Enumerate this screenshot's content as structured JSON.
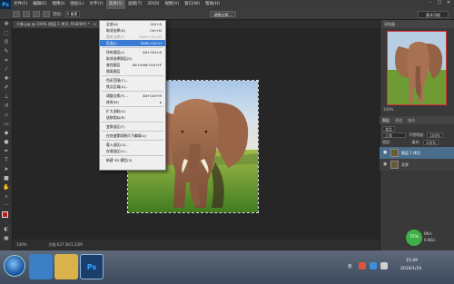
{
  "app": {
    "logo": "Ps",
    "menu": [
      "文件(F)",
      "编辑(E)",
      "图像(I)",
      "图层(L)",
      "文字(Y)",
      "选择(S)",
      "滤镜(T)",
      "3D(D)",
      "视图(V)",
      "窗口(W)",
      "帮助(H)"
    ],
    "active_menu_index": 5,
    "window_controls": [
      "–",
      "□",
      "✕"
    ]
  },
  "options_bar": {
    "feather_label": "羽化:",
    "feather_value": "0 像素",
    "refine_edge": "调整边缘...",
    "workspace": "基本功能"
  },
  "document_tab": {
    "title": "大象.jpg @ 100% (图层 1 拷贝, RGB/8#) *",
    "close": "×"
  },
  "select_menu": {
    "items": [
      {
        "label": "全部(A)",
        "shortcut": "Ctrl+A",
        "state": "normal"
      },
      {
        "label": "取消选择(D)",
        "shortcut": "Ctrl+D",
        "state": "normal"
      },
      {
        "label": "重新选择(E)",
        "shortcut": "Shift+Ctrl+D",
        "state": "disabled"
      },
      {
        "label": "反选(I)",
        "shortcut": "Shift+Ctrl+I",
        "state": "highlighted"
      },
      {
        "sep": true
      },
      {
        "label": "所有图层(L)",
        "shortcut": "Alt+Ctrl+A",
        "state": "normal"
      },
      {
        "label": "取消选择图层(S)",
        "shortcut": "",
        "state": "normal"
      },
      {
        "label": "查找图层",
        "shortcut": "Alt+Shift+Ctrl+F",
        "state": "normal"
      },
      {
        "label": "隔离图层",
        "shortcut": "",
        "state": "normal"
      },
      {
        "sep": true
      },
      {
        "label": "色彩范围(C)...",
        "shortcut": "",
        "state": "normal"
      },
      {
        "label": "焦点区域(U)...",
        "shortcut": "",
        "state": "normal"
      },
      {
        "sep": true
      },
      {
        "label": "调整边缘(F)...",
        "shortcut": "Alt+Ctrl+R",
        "state": "normal"
      },
      {
        "label": "修改(M)",
        "shortcut": "▸",
        "state": "normal"
      },
      {
        "sep": true
      },
      {
        "label": "扩大选取(G)",
        "shortcut": "",
        "state": "normal"
      },
      {
        "label": "选取相似(R)",
        "shortcut": "",
        "state": "normal"
      },
      {
        "sep": true
      },
      {
        "label": "变换选区(T)",
        "shortcut": "",
        "state": "normal"
      },
      {
        "sep": true
      },
      {
        "label": "在快速蒙版模式下编辑(Q)",
        "shortcut": "",
        "state": "normal"
      },
      {
        "sep": true
      },
      {
        "label": "载入选区(O)...",
        "shortcut": "",
        "state": "normal"
      },
      {
        "label": "存储选区(V)...",
        "shortcut": "",
        "state": "normal"
      },
      {
        "sep": true
      },
      {
        "label": "新建 3D 模型(3)",
        "shortcut": "",
        "state": "normal"
      }
    ]
  },
  "status_bar": {
    "zoom": "100%",
    "doc_info": "文档:627.5K/1.22M"
  },
  "navigator": {
    "header": "导航器",
    "zoom": "100%"
  },
  "layers_panel": {
    "tabs": [
      "图层",
      "通道",
      "路径"
    ],
    "active_tab": 0,
    "kind_label": "类型",
    "blend_mode": "正常",
    "opacity_label": "不透明度:",
    "opacity": "100%",
    "lock_label": "锁定:",
    "fill_label": "填充:",
    "fill": "100%",
    "layers": [
      {
        "name": "图层 1 拷贝",
        "selected": true
      },
      {
        "name": "背景",
        "selected": false
      }
    ]
  },
  "widget": {
    "percent": "75%",
    "line1": "0K/s",
    "line2": "0.6K/s"
  },
  "tray": {
    "ime": "英",
    "time": "15:49",
    "date": "2016/1/16"
  },
  "colors": {
    "accent": "#3a7bd5",
    "ps_blue": "#31a8ff",
    "selected_layer": "#4a6d8c"
  }
}
